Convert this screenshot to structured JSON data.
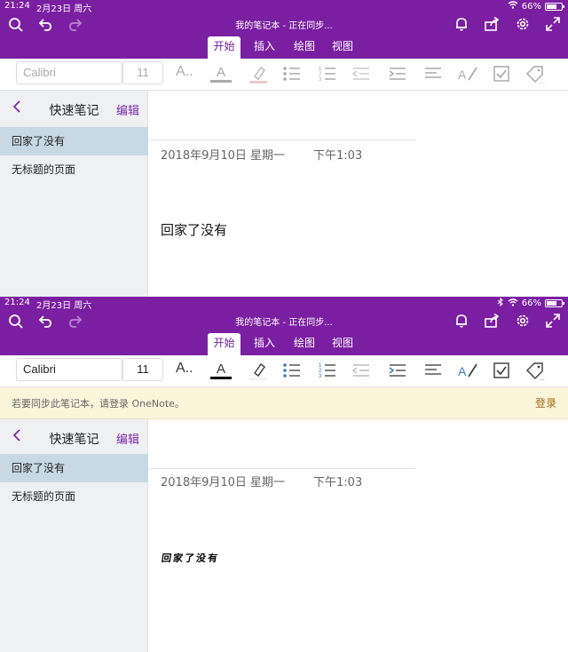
{
  "colors": {
    "accent": "#7b1fa2",
    "accent_dark": "#6f1f9a",
    "banner": "#fbf5dc",
    "selected_page": "#c8d9e4"
  },
  "screens": [
    {
      "status": {
        "time": "21:24",
        "date": "2月23日 周六",
        "battery": "66%",
        "battery_level": 0.66
      },
      "notebook_title": "我的笔记本 - 正在同步...",
      "tabs": [
        "开始",
        "插入",
        "绘图",
        "视图"
      ],
      "active_tab": "开始",
      "ribbon": {
        "font": "Calibri",
        "size": "11",
        "font_style_label": "A..",
        "font_color_label": "A"
      },
      "section": {
        "title": "快速笔记",
        "edit_label": "编辑"
      },
      "pages": [
        {
          "title": "回家了没有",
          "selected": true
        },
        {
          "title": "无标题的页面",
          "selected": false
        }
      ],
      "note": {
        "date": "2018年9月10日 星期一",
        "time": "下午1:03",
        "body": "回家了没有"
      }
    },
    {
      "status": {
        "time": "21:24",
        "date": "2月23日 周六",
        "battery": "66%",
        "battery_level": 0.66
      },
      "notebook_title": "我的笔记本 - 正在同步...",
      "tabs": [
        "开始",
        "插入",
        "绘图",
        "视图"
      ],
      "active_tab": "开始",
      "ribbon": {
        "font": "Calibri",
        "size": "11",
        "font_style_label": "A..",
        "font_color_label": "A"
      },
      "banner": {
        "message": "若要同步此笔记本，请登录 OneNote。",
        "action": "登录"
      },
      "section": {
        "title": "快速笔记",
        "edit_label": "编辑"
      },
      "pages": [
        {
          "title": "回家了没有",
          "selected": true
        },
        {
          "title": "无标题的页面",
          "selected": false
        }
      ],
      "note": {
        "date": "2018年9月10日 星期一",
        "time": "下午1:03",
        "body": "回家了没有"
      }
    }
  ]
}
